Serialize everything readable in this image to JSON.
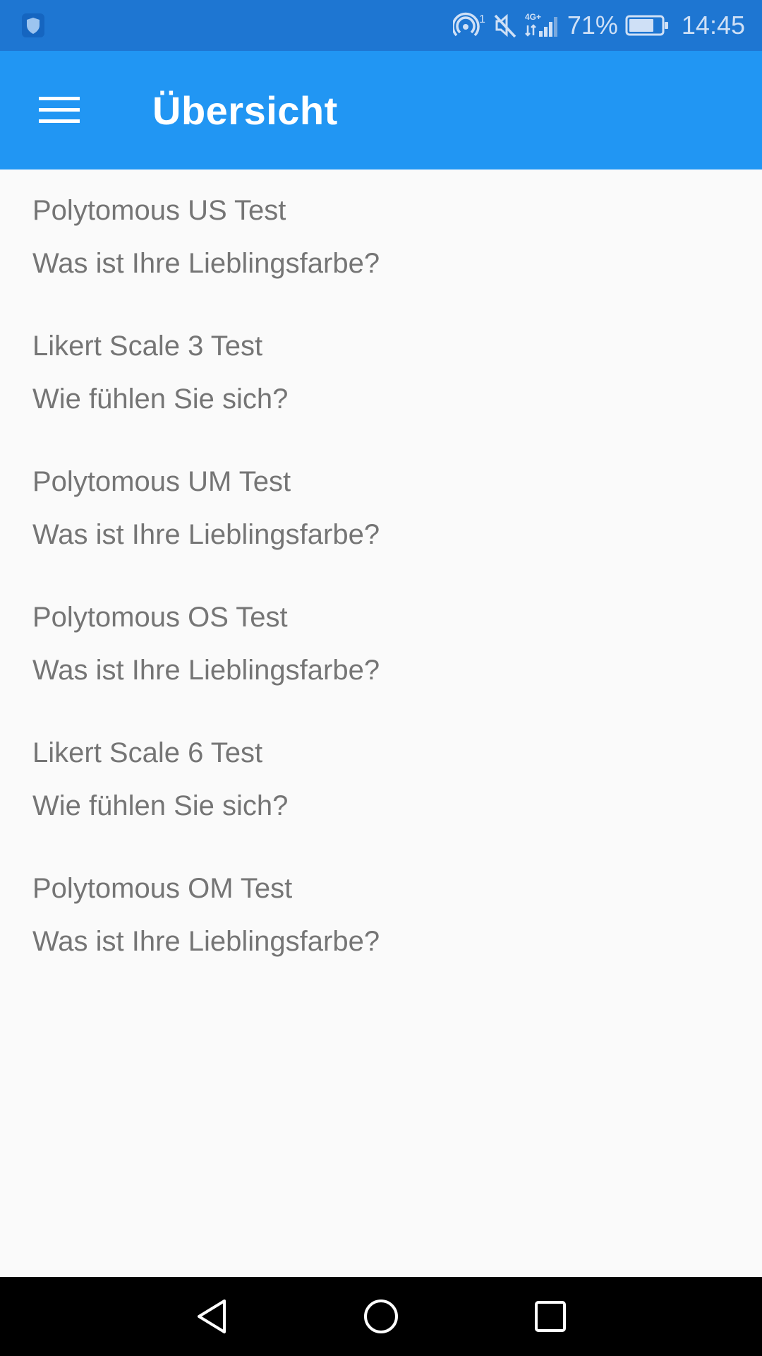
{
  "status_bar": {
    "battery_percent": "71%",
    "time": "14:45",
    "icons": [
      "shield-icon",
      "hotspot-icon",
      "mute-icon",
      "signal-4g-icon",
      "battery-icon"
    ],
    "hotspot_count": "1",
    "network_label": "4G+"
  },
  "app_bar": {
    "title": "Übersicht",
    "menu_icon": "hamburger-menu-icon"
  },
  "items": [
    {
      "title": "Polytomous US Test",
      "subtitle": "Was ist Ihre Lieblingsfarbe?"
    },
    {
      "title": "Likert Scale 3 Test",
      "subtitle": "Wie fühlen Sie sich?"
    },
    {
      "title": "Polytomous UM Test",
      "subtitle": "Was ist Ihre Lieblingsfarbe?"
    },
    {
      "title": "Polytomous OS Test",
      "subtitle": "Was ist Ihre Lieblingsfarbe?"
    },
    {
      "title": "Likert Scale 6 Test",
      "subtitle": "Wie fühlen Sie sich?"
    },
    {
      "title": "Polytomous OM Test",
      "subtitle": "Was ist Ihre Lieblingsfarbe?"
    }
  ],
  "nav_bar": {
    "icons": [
      "back-icon",
      "home-icon",
      "recents-icon"
    ]
  },
  "colors": {
    "status_bar": "#1e76d2",
    "app_bar": "#2196f3",
    "background": "#fafafa",
    "text": "#757575"
  }
}
